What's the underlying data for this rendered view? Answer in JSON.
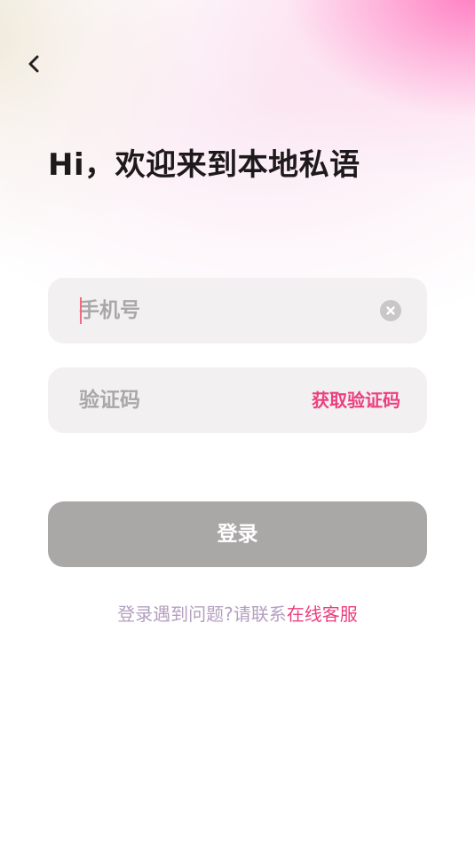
{
  "header": {
    "back_icon": "chevron-left-icon",
    "welcome_title": "Hi，欢迎来到本地私语"
  },
  "form": {
    "phone": {
      "value": "",
      "placeholder": "手机号",
      "clear_icon": "clear-circle-icon"
    },
    "code": {
      "value": "",
      "placeholder": "验证码",
      "get_code_label": "获取验证码"
    },
    "login_label": "登录"
  },
  "help": {
    "prefix": "登录遇到问题?请联系",
    "link_label": "在线客服"
  },
  "colors": {
    "accent": "#ec3f7e",
    "login_button_disabled": "#aaa7a7",
    "field_background": "#f2f0f1",
    "help_text": "#b49fc0",
    "title_text": "#1e1a1c",
    "gradient_pink": "#ff76be"
  }
}
